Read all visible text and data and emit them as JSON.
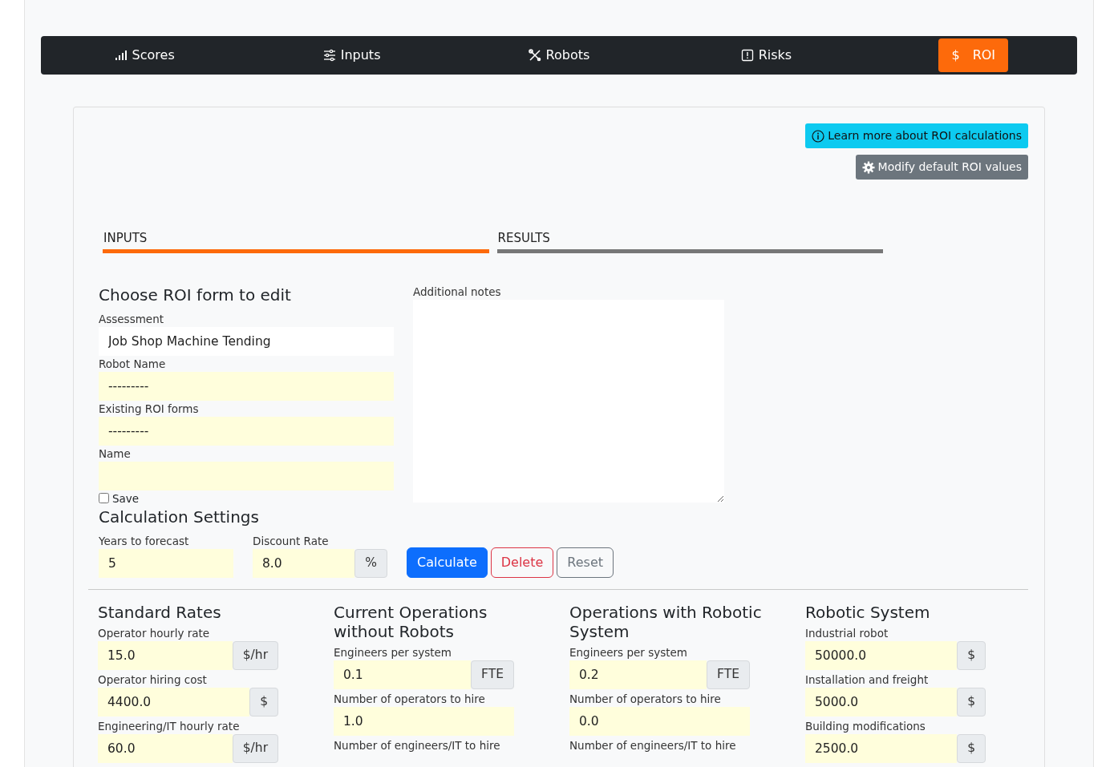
{
  "nav": [
    {
      "label": "Scores",
      "selected": false
    },
    {
      "label": "Inputs",
      "selected": false
    },
    {
      "label": "Robots",
      "selected": false
    },
    {
      "label": "Risks",
      "selected": false
    },
    {
      "label": "ROI",
      "glyph": "$",
      "selected": true
    }
  ],
  "actions": [
    {
      "label": "Learn more about ROI calculations",
      "kind": "info"
    },
    {
      "label": "Modify default ROI values",
      "kind": "settings"
    }
  ],
  "tabs": [
    {
      "label": "INPUTS",
      "selected": true
    },
    {
      "label": "RESULTS",
      "selected": false
    }
  ],
  "choose": {
    "title": "Choose ROI form to edit",
    "fields": [
      {
        "label": "Assessment",
        "value": "Job Shop Machine Tending",
        "readonly": true
      },
      {
        "label": "Robot Name",
        "value": "---------",
        "readonly": false
      },
      {
        "label": "Existing ROI forms",
        "value": "---------",
        "readonly": false
      },
      {
        "label": "Name",
        "readonly": false
      }
    ],
    "save": {
      "label": "Save",
      "checked": false
    }
  },
  "notes": {
    "label": "Additional notes"
  },
  "settings": {
    "title": "Calculation Settings",
    "fields": [
      {
        "label": "Years to forecast",
        "value": "5"
      },
      {
        "label": "Discount Rate",
        "value": "8.0",
        "unit": "%"
      }
    ],
    "buttons": [
      {
        "label": "Calculate",
        "kind": "primary"
      },
      {
        "label": "Delete",
        "kind": "danger"
      },
      {
        "label": "Reset",
        "kind": "secondary"
      }
    ]
  },
  "sections": [
    {
      "title": "Standard Rates",
      "fields": [
        {
          "label": "Operator hourly rate",
          "value": "15.0",
          "unit": "$/hr"
        },
        {
          "label": "Operator hiring cost",
          "value": "4400.0",
          "unit": "$"
        },
        {
          "label": "Engineering/IT hourly rate",
          "value": "60.0",
          "unit": "$/hr"
        }
      ]
    },
    {
      "title": "Current Operations without Robots",
      "fields": [
        {
          "label": "Engineers per system",
          "value": "0.1",
          "unit": "FTE"
        },
        {
          "label": "Number of operators to hire",
          "value": "1.0"
        },
        {
          "label": "Number of engineers/IT to hire"
        }
      ]
    },
    {
      "title": "Operations with Robotic System",
      "fields": [
        {
          "label": "Engineers per system",
          "value": "0.2",
          "unit": "FTE"
        },
        {
          "label": "Number of operators to hire",
          "value": "0.0"
        },
        {
          "label": "Number of engineers/IT to hire"
        }
      ]
    },
    {
      "title": "Robotic System",
      "fields": [
        {
          "label": "Industrial robot",
          "value": "50000.0",
          "unit": "$"
        },
        {
          "label": "Installation and freight",
          "value": "5000.0",
          "unit": "$"
        },
        {
          "label": "Building modifications",
          "value": "2500.0",
          "unit": "$"
        }
      ]
    }
  ]
}
